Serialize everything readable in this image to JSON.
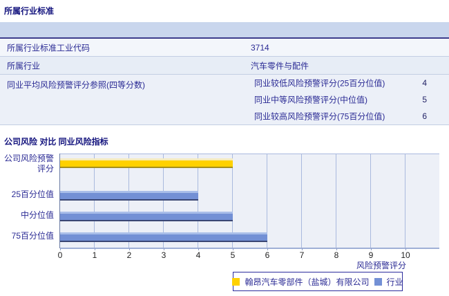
{
  "section1": {
    "title": "所属行业标准",
    "table": {
      "rows": [
        {
          "label": "所属行业标准工业代码",
          "value": "3714"
        },
        {
          "label": "所属行业",
          "value": "汽车零件与配件"
        },
        {
          "label": "同业平均风险预警评分参照(四等分数)",
          "sub_rows": [
            {
              "label": "同业较低风险预警评分(25百分位值)",
              "value": "4"
            },
            {
              "label": "同业中等风险预警评分(中位值)",
              "value": "5"
            },
            {
              "label": "同业较高风险预警评分(75百分位值)",
              "value": "6"
            }
          ]
        }
      ]
    }
  },
  "section2": {
    "title": "公司风险 对比 同业风险指标",
    "chart_data": {
      "type": "bar",
      "orientation": "horizontal",
      "categories": [
        "公司风险预警评分",
        "25百分位值",
        "中分位值",
        "75百分位值"
      ],
      "series": [
        {
          "name": "翰昂汽车零部件（盐城）有限公司",
          "color": "#FFD100",
          "edge_top": "#F6ECBE",
          "edge_bottom": "#A38F1F",
          "values": [
            5,
            null,
            null,
            null
          ]
        },
        {
          "name": "行业",
          "color": "#7390D5",
          "edge_top": "#A9BEE9",
          "edge_bottom": "#3A4673",
          "values": [
            null,
            4,
            5,
            6
          ]
        }
      ],
      "xlabel": "风险预警评分",
      "xlim": [
        0,
        10
      ],
      "xticks": [
        "0",
        "1",
        "2",
        "3",
        "4",
        "5",
        "6",
        "7",
        "8",
        "9",
        "10"
      ],
      "grid": "vertical",
      "legend_position": "bottom-right",
      "plot_bg": "#EDF0F7",
      "gridline_color": "#A9B9DE"
    }
  }
}
